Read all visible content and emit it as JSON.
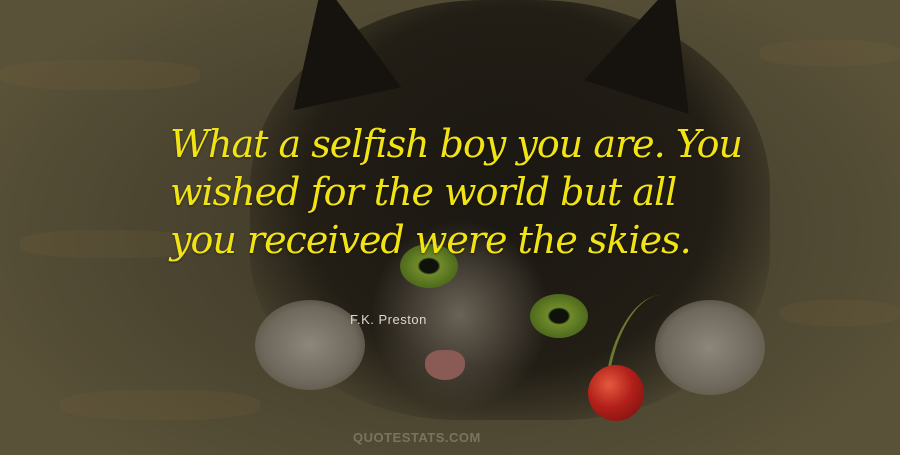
{
  "quote": {
    "text": "What a selfish boy you are. You wished for the world but all you received were the skies.",
    "author": "F.K. Preston"
  },
  "watermark": {
    "text": "QUOTESTATS.COM"
  },
  "colors": {
    "quote_text": "#f2e414",
    "author_text": "#ddd8c8",
    "background": "#3a3424"
  }
}
